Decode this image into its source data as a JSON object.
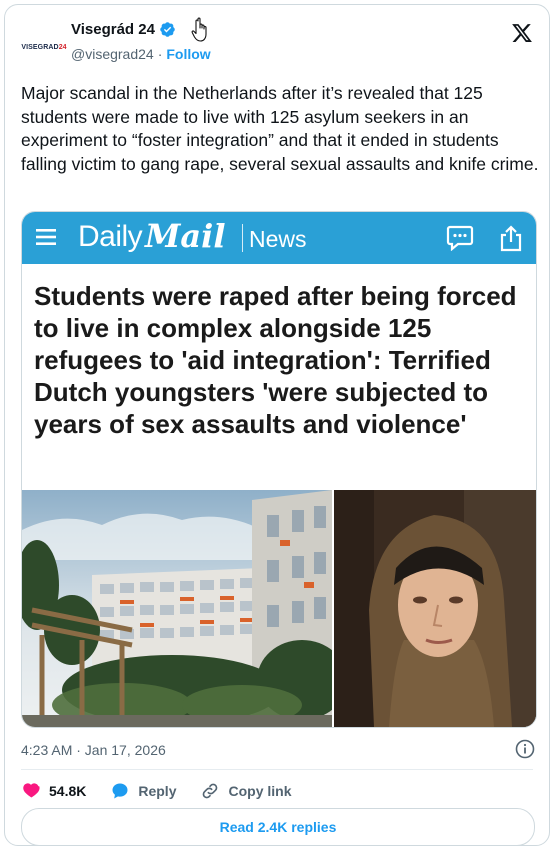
{
  "author": {
    "avatar_text_main": "VISEGRAD",
    "avatar_text_accent": "24",
    "name": "Visegrád 24",
    "handle": "@visegrad24",
    "separator": "·",
    "follow_label": "Follow"
  },
  "tweet": {
    "text": "Major scandal in the Netherlands after it’s revealed that 125 students were made to live with 125 asylum seekers in an experiment to “foster integration” and that it ended in students falling victim to gang rape, several sexual assaults and knife crime.",
    "timestamp": "4:23 AM · Jan 17, 2026"
  },
  "embed": {
    "brand_daily": "Daily",
    "brand_mail": "Mail",
    "section": "News",
    "headline": "Students were raped after being forced to live in complex alongside 125 refugees to 'aid integration': Terrified Dutch youngsters 'were subjected to years of sex assaults and violence'",
    "bar_color": "#2aa0d6"
  },
  "actions": {
    "like_count": "54.8K",
    "reply_label": "Reply",
    "copy_label": "Copy link",
    "like_color": "#f91880",
    "accent_color": "#1d9bf0"
  },
  "replies_label": "Read 2.4K replies",
  "icons": [
    "verified-badge-icon",
    "hand-cursor-icon",
    "x-logo-icon",
    "menu-icon",
    "comment-icon",
    "share-icon",
    "info-icon",
    "heart-icon",
    "reply-bubble-icon",
    "link-icon"
  ]
}
